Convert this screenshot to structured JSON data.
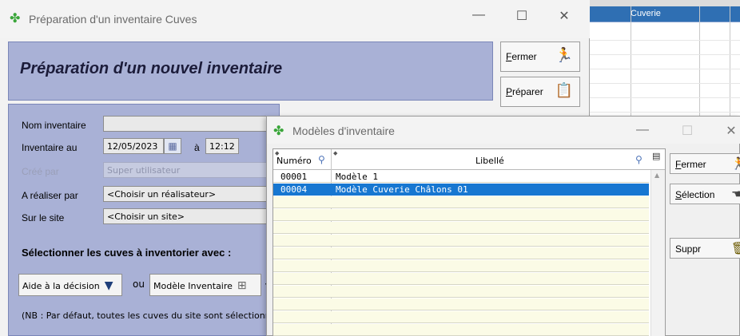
{
  "background": {
    "grid_header": "Cuverie"
  },
  "main_window": {
    "title": "Préparation d'un inventaire Cuves",
    "controls": {
      "minimize": "—",
      "maximize": "☐",
      "close": "✕"
    },
    "header_title": "Préparation d'un nouvel inventaire",
    "buttons": {
      "fermer": {
        "accel": "F",
        "rest": "ermer"
      },
      "preparer": {
        "accel": "P",
        "rest": "réparer"
      }
    },
    "form": {
      "nom_label": "Nom inventaire",
      "nom_value": "",
      "inventaire_au_label": "Inventaire au",
      "date_value": "12/05/2023",
      "a_label": "à",
      "time_value": "12:12",
      "cree_par_label": "Créé par",
      "cree_par_value": "Super utilisateur",
      "realiser_label": "A réaliser par",
      "realiser_value": "<Choisir un réalisateur>",
      "site_label": "Sur le site",
      "site_value": "<Choisir un site>",
      "section_title": "Sélectionner les cuves à inventorier avec :",
      "aide_button": "Aide à la décision",
      "ou_text": "ou",
      "modele_button": "Modèle Inventaire",
      "after_modele": "·",
      "nb_text": "(NB : Par défaut, toutes les cuves du site sont sélectionn"
    }
  },
  "modal": {
    "title": "Modèles d'inventaire",
    "controls": {
      "minimize": "—",
      "maximize": "☐",
      "close": "✕"
    },
    "table": {
      "headers": {
        "numero": "Numéro",
        "libelle": "Libellé"
      },
      "rows": [
        {
          "numero": "00001",
          "libelle": "Modèle 1"
        },
        {
          "numero": "00004",
          "libelle": "Modèle Cuverie Châlons 01"
        }
      ],
      "selected_index": 1
    },
    "buttons": {
      "fermer": {
        "accel": "F",
        "rest": "ermer"
      },
      "selection": {
        "accel": "S",
        "rest": "élection"
      },
      "suppr": {
        "accel": "",
        "rest": "Suppr"
      }
    }
  },
  "colors": {
    "panel": "#a9b1d6",
    "selection": "#1777d1",
    "row_empty": "#fbfbe6"
  },
  "icons": {
    "app": "leaf-icon",
    "fermer": "exit-runner-icon",
    "preparer": "clipboard-icon",
    "calendar": "calendar-icon",
    "aide": "funnel-icon",
    "modele": "template-icon",
    "search": "search-icon",
    "selection": "pointer-hand-icon",
    "suppr": "trash-icon"
  }
}
